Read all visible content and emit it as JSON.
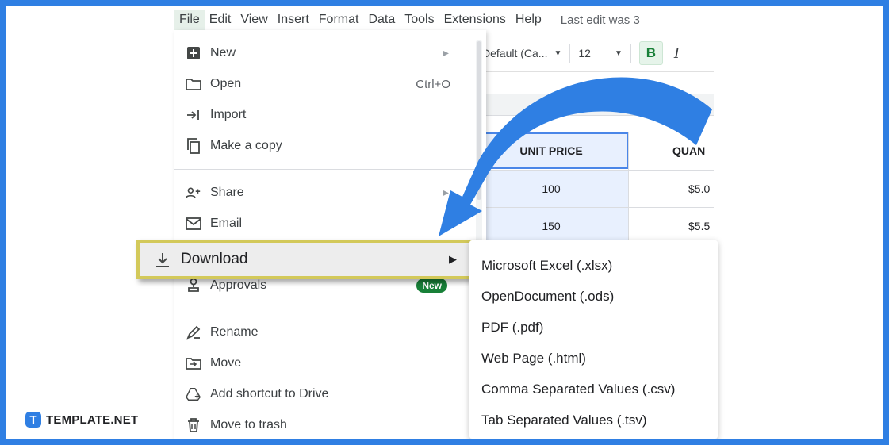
{
  "menubar": {
    "items": [
      "File",
      "Edit",
      "View",
      "Insert",
      "Format",
      "Data",
      "Tools",
      "Extensions",
      "Help"
    ],
    "last_edit": "Last edit was 3"
  },
  "toolbar": {
    "font": "Default (Ca...",
    "font_size": "12",
    "bold": "B",
    "italic": "I"
  },
  "sheet": {
    "headers": [
      "UNIT PRICE",
      "QUAN"
    ],
    "rows": [
      [
        "100",
        "$5.0"
      ],
      [
        "150",
        "$5.5"
      ]
    ]
  },
  "file_menu": {
    "items": [
      {
        "label": "New",
        "icon": "plus-box-icon",
        "has_submenu": true
      },
      {
        "label": "Open",
        "icon": "folder-icon",
        "shortcut": "Ctrl+O"
      },
      {
        "label": "Import",
        "icon": "import-icon"
      },
      {
        "label": "Make a copy",
        "icon": "copy-icon"
      },
      {
        "label": "Share",
        "icon": "person-add-icon",
        "has_submenu": true
      },
      {
        "label": "Email",
        "icon": "mail-icon",
        "has_submenu": true
      },
      {
        "label": "Download",
        "icon": "download-icon",
        "has_submenu": true
      },
      {
        "label": "Approvals",
        "icon": "stamp-icon",
        "badge": "New"
      },
      {
        "label": "Rename",
        "icon": "pencil-icon"
      },
      {
        "label": "Move",
        "icon": "move-folder-icon"
      },
      {
        "label": "Add shortcut to Drive",
        "icon": "drive-shortcut-icon"
      },
      {
        "label": "Move to trash",
        "icon": "trash-icon"
      }
    ]
  },
  "download_submenu": {
    "items": [
      "Microsoft Excel (.xlsx)",
      "OpenDocument (.ods)",
      "PDF (.pdf)",
      "Web Page (.html)",
      "Comma Separated Values (.csv)",
      "Tab Separated Values (.tsv)"
    ]
  },
  "annotation": {
    "highlight_color": "#d3c95a",
    "arrow_color": "#2f7fe3"
  },
  "brand": {
    "logo_letter": "T",
    "name": "TEMPLATE.NET"
  }
}
